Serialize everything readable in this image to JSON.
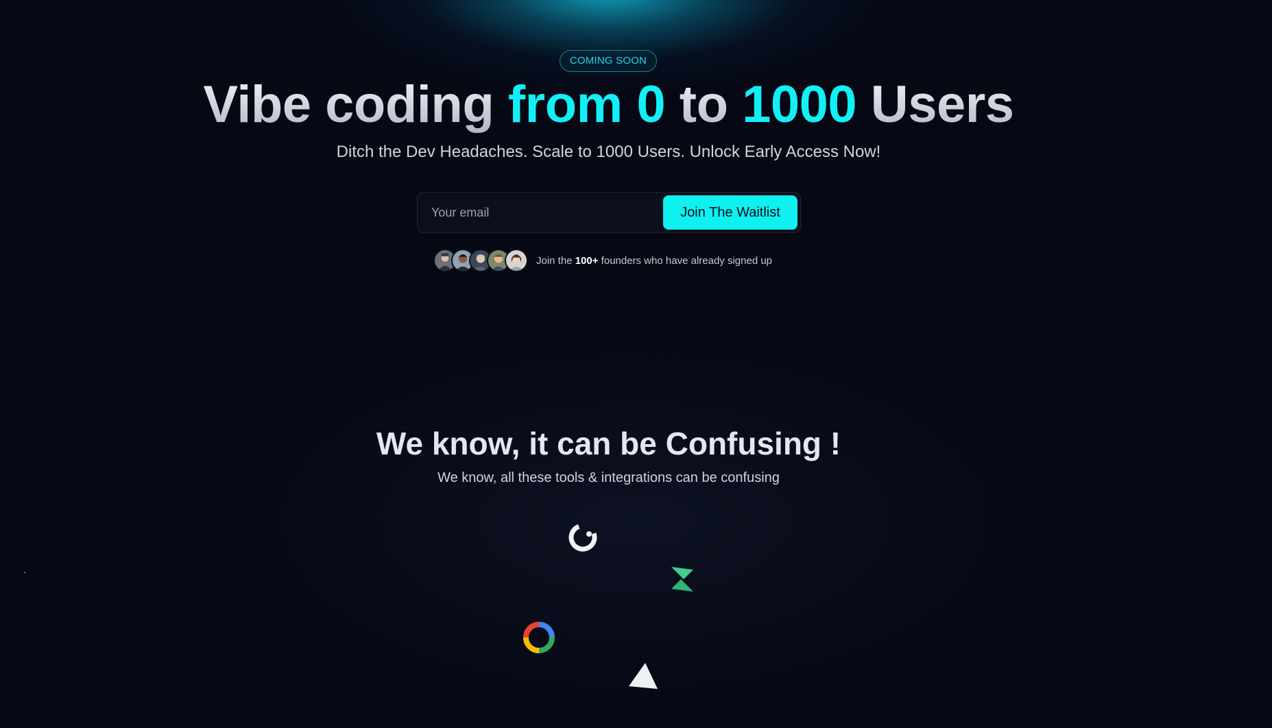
{
  "hero": {
    "badge": "COMING SOON",
    "headline": {
      "part1": "Vibe coding ",
      "part2": "from 0",
      "part3": " to ",
      "part4": "1000",
      "part5": " Users"
    },
    "subheadline": "Ditch the Dev Headaches. Scale to 1000 Users. Unlock Early Access Now!"
  },
  "waitlist": {
    "email_placeholder": "Your email",
    "button_label": "Join The Waitlist"
  },
  "social_proof": {
    "prefix": "Join the ",
    "count": "100+",
    "suffix": " founders who have already signed up",
    "avatars": [
      "avatar-1",
      "avatar-2",
      "avatar-3",
      "avatar-4",
      "avatar-5"
    ]
  },
  "section2": {
    "title": "We know, it can be Confusing !",
    "subtitle": "We know, all these tools & integrations can be confusing"
  },
  "icons": [
    "circular-logo-icon",
    "bolt-logo-icon",
    "google-ring-icon",
    "triangle-logo-icon"
  ],
  "colors": {
    "accent": "#11f0f4",
    "background": "#060814",
    "button": "#0ff0f0"
  }
}
